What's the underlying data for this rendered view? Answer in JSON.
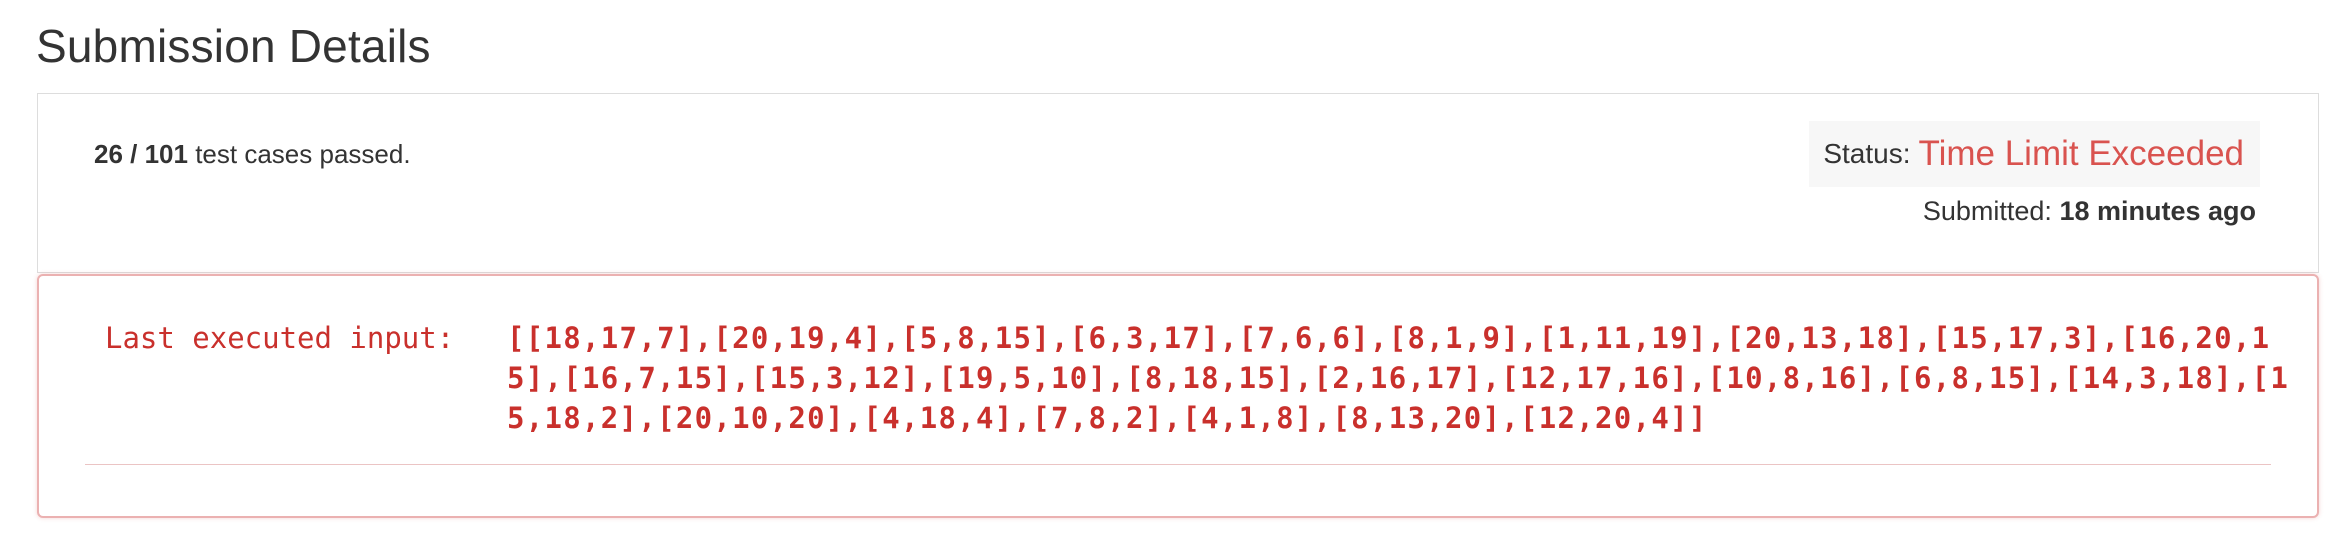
{
  "page": {
    "title": "Submission Details"
  },
  "summary": {
    "passed_count": "26 / 101",
    "passed_suffix": " test cases passed.",
    "status_label": "Status:",
    "status_value": "Time Limit Exceeded",
    "submitted_label": "Submitted:",
    "submitted_value": "18 minutes ago"
  },
  "error": {
    "label": "Last executed input:",
    "value": "[[18,17,7],[20,19,4],[5,8,15],[6,3,17],[7,6,6],[8,1,9],[1,11,19],[20,13,18],[15,17,3],[16,20,15],[16,7,15],[15,3,12],[19,5,10],[8,18,15],[2,16,17],[12,17,16],[10,8,16],[6,8,15],[14,3,18],[15,18,2],[20,10,20],[4,18,4],[7,8,2],[4,1,8],[8,13,20],[12,20,4]]"
  },
  "colors": {
    "error_red": "#d9534f",
    "text_dark": "#333333"
  }
}
